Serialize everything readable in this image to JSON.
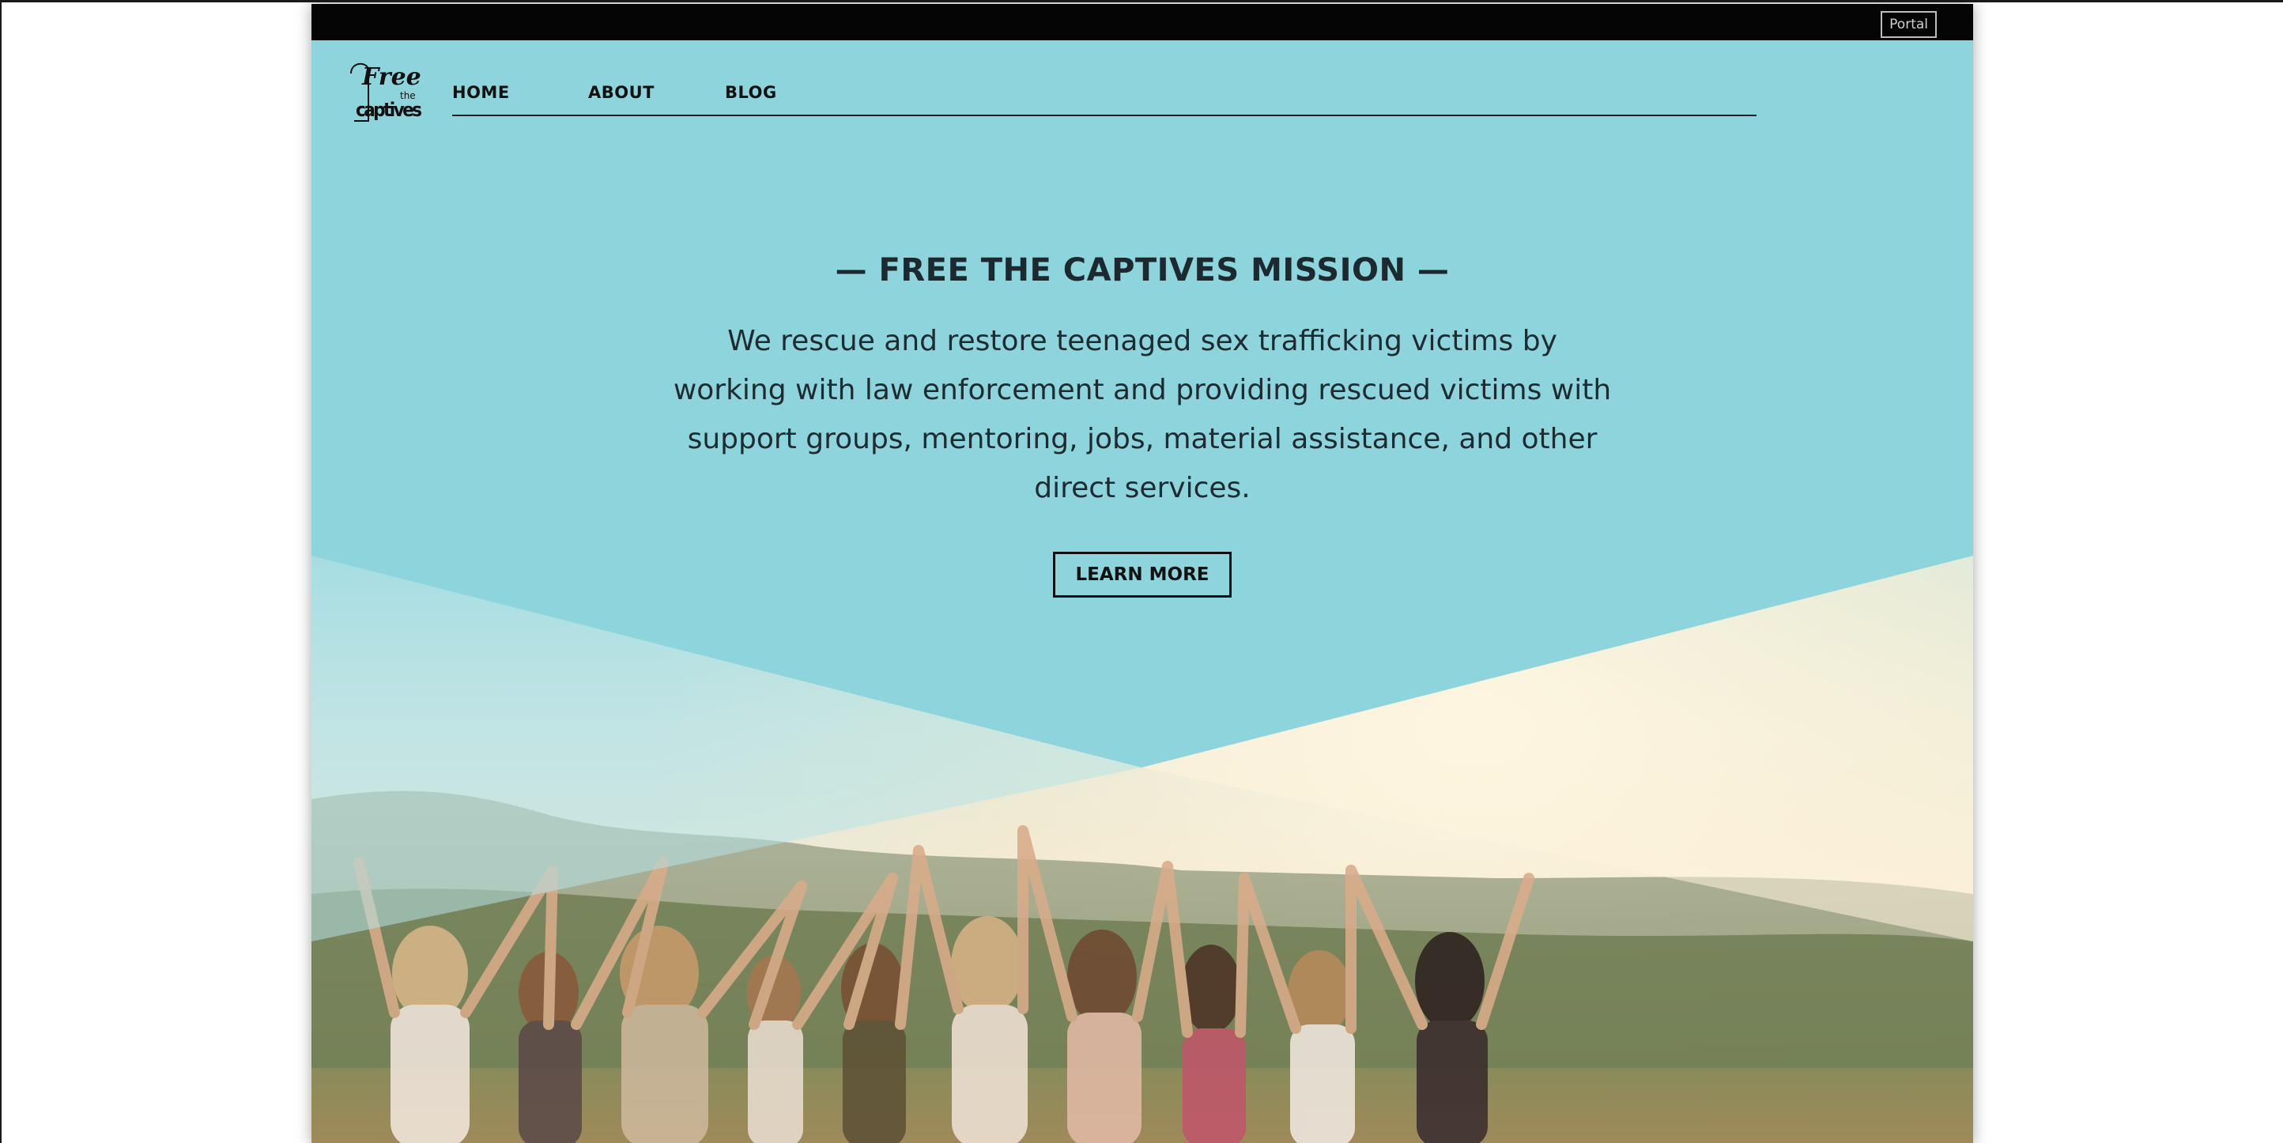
{
  "topbar": {
    "portal_label": "Portal"
  },
  "logo": {
    "line1": "Free",
    "line2": "the",
    "line3": "captives"
  },
  "nav": {
    "items": [
      {
        "label": "HOME"
      },
      {
        "label": "ABOUT"
      },
      {
        "label": "BLOG"
      }
    ]
  },
  "hero": {
    "headline": "— FREE THE CAPTIVES MISSION —",
    "mission_text": "We rescue and restore teenaged sex trafficking victims by working with law enforcement and providing rescued victims with support groups, mentoring, jobs, material assistance,  and other direct services.",
    "cta_label": "LEARN MORE",
    "background_image": "group-of-women-holding-hands-raised-at-sunset"
  },
  "colors": {
    "hero_teal": "#8dd4dc",
    "topbar_black": "#050505",
    "text_dark": "#1c2a30",
    "sunlight_cream": "#fbf1dc"
  }
}
